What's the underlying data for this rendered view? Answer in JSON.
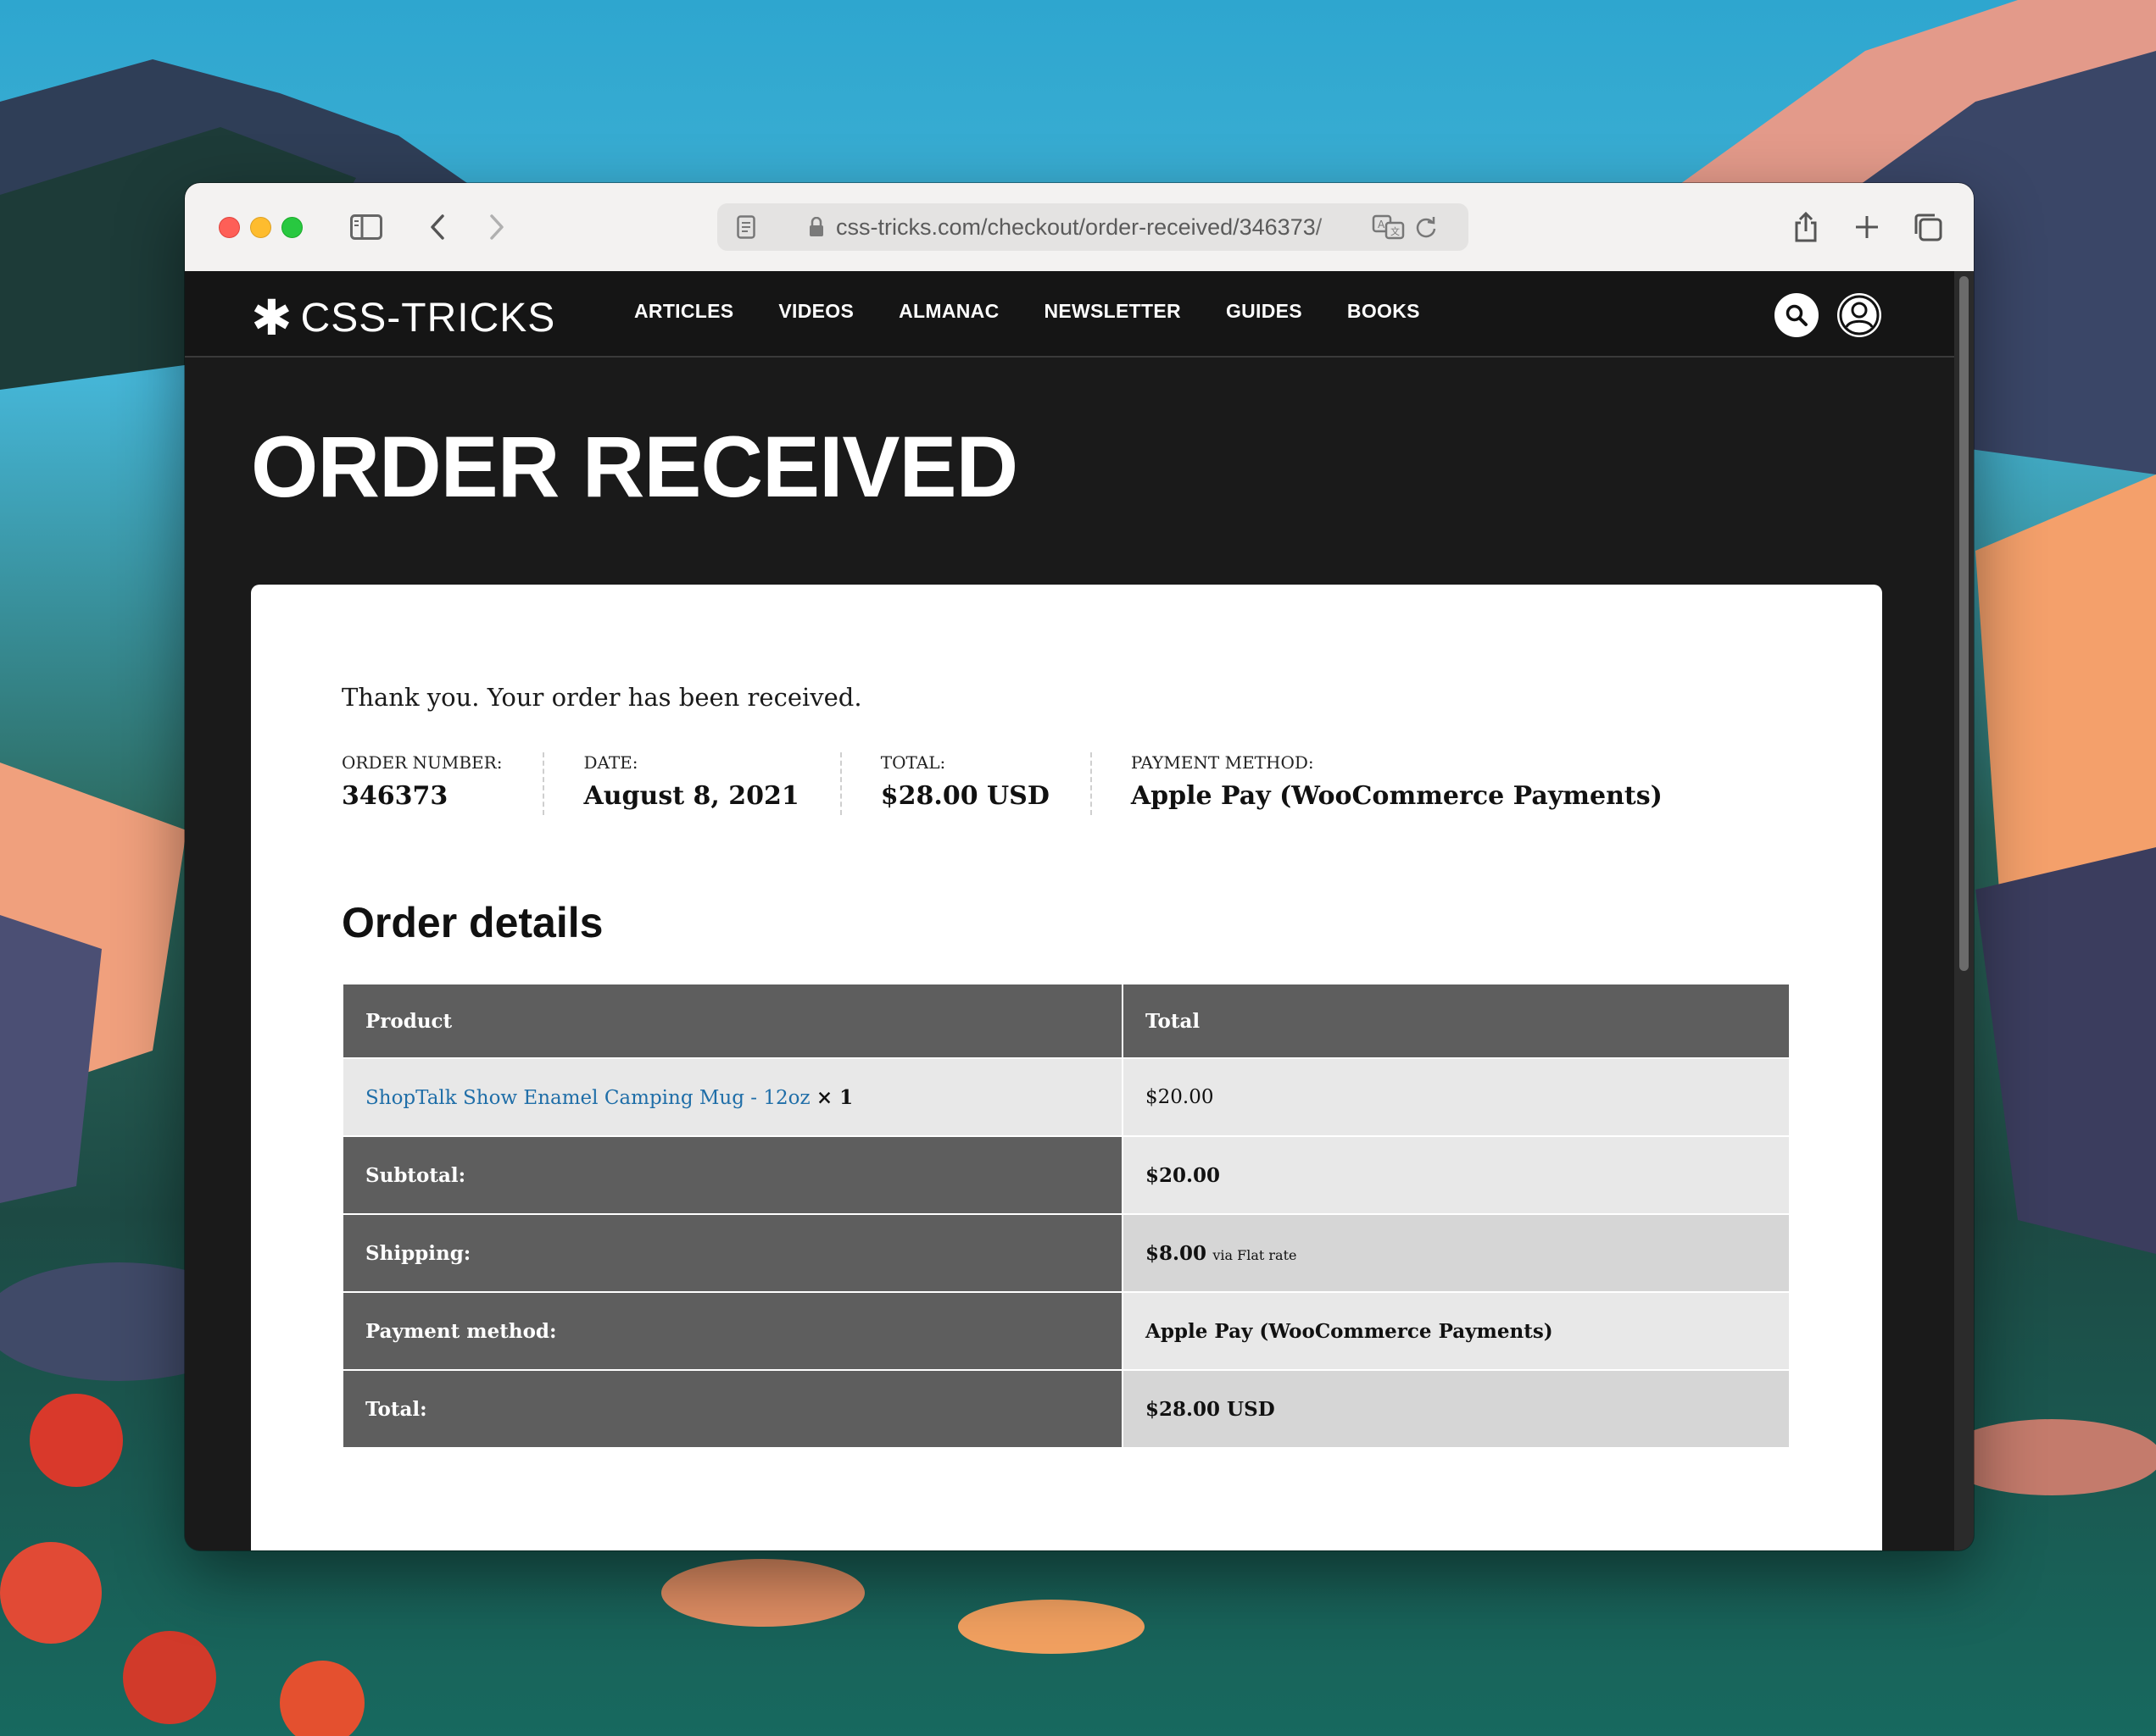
{
  "browser": {
    "url": "css-tricks.com/checkout/order-received/346373/",
    "icons": [
      "sidebar-icon",
      "back-icon",
      "forward-icon",
      "password-manager-icon",
      "privacy-shield-icon",
      "reader-icon",
      "lock-icon",
      "translate-icon",
      "reload-icon",
      "share-icon",
      "new-tab-icon",
      "tabs-overview-icon"
    ]
  },
  "site": {
    "logo_star": "✱",
    "logo_text": "CSS-TRICKS",
    "nav": [
      "ARTICLES",
      "VIDEOS",
      "ALMANAC",
      "NEWSLETTER",
      "GUIDES",
      "BOOKS"
    ],
    "icons": [
      "search-icon",
      "account-icon"
    ]
  },
  "page": {
    "title": "ORDER RECEIVED",
    "thanks": "Thank you. Your order has been received.",
    "overview": [
      {
        "label": "ORDER NUMBER:",
        "value": "346373"
      },
      {
        "label": "DATE:",
        "value": "August 8, 2021"
      },
      {
        "label": "TOTAL:",
        "value": "$28.00 USD"
      },
      {
        "label": "PAYMENT METHOD:",
        "value": "Apple Pay (WooCommerce Payments)"
      }
    ],
    "details_heading": "Order details",
    "table": {
      "headers": [
        "Product",
        "Total"
      ],
      "item": {
        "name": "ShopTalk Show Enamel Camping Mug - 12oz",
        "qty": "× 1",
        "total": "$20.00"
      },
      "rows": [
        {
          "label": "Subtotal:",
          "value": "$20.00"
        },
        {
          "label": "Shipping:",
          "value": "$8.00",
          "note": "via Flat rate"
        },
        {
          "label": "Payment method:",
          "value": "Apple Pay (WooCommerce Payments)"
        },
        {
          "label": "Total:",
          "value": "$28.00 USD"
        }
      ]
    }
  }
}
